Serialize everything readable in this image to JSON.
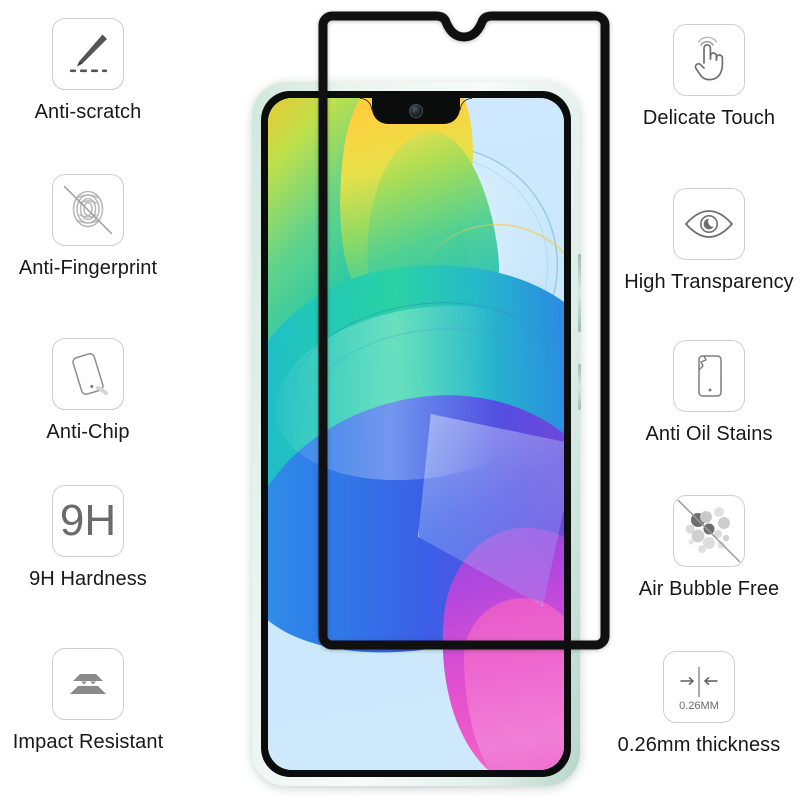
{
  "product": {
    "type": "tempered-glass-screen-protector-infographic",
    "background_color": "#ffffff",
    "text_color": "#181818",
    "icon_color": "#555555",
    "icon_border_color": "#cfcfcf",
    "protector_frame_color": "#111111"
  },
  "features_left": [
    {
      "label": "Anti-scratch",
      "icon": "pen-scratch-icon"
    },
    {
      "label": "Anti-Fingerprint",
      "icon": "fingerprint-slash-icon"
    },
    {
      "label": "Anti-Chip",
      "icon": "tilted-phone-icon"
    },
    {
      "label": "9H Hardness",
      "icon": "9h-hardness-icon",
      "icon_text": "9H"
    },
    {
      "label": "Impact Resistant",
      "icon": "impact-plates-icon"
    }
  ],
  "features_right": [
    {
      "label": "Delicate Touch",
      "icon": "hand-tap-icon"
    },
    {
      "label": "High Transparency",
      "icon": "eye-icon"
    },
    {
      "label": "Anti Oil Stains",
      "icon": "cracked-phone-icon"
    },
    {
      "label": "Air Bubble Free",
      "icon": "bubbles-slash-icon"
    },
    {
      "label": "0.26mm thickness",
      "icon": "thickness-arrows-icon",
      "icon_text": "0.26MM"
    }
  ],
  "phone": {
    "name": "smartphone-with-waterdrop-notch",
    "frame_color": "#d9ece5",
    "bezel_color": "#0b0d0c",
    "screen": {
      "wallpaper": "abstract-flowing-ribbon-gradient",
      "palette": [
        "#cfeaff",
        "#ffd24a",
        "#bfe04b",
        "#2ad2a4",
        "#1fb5d8",
        "#3b5fe6",
        "#8d4ae0",
        "#f05cc8"
      ]
    },
    "side_buttons": [
      "volume-rocker",
      "power-button"
    ]
  }
}
